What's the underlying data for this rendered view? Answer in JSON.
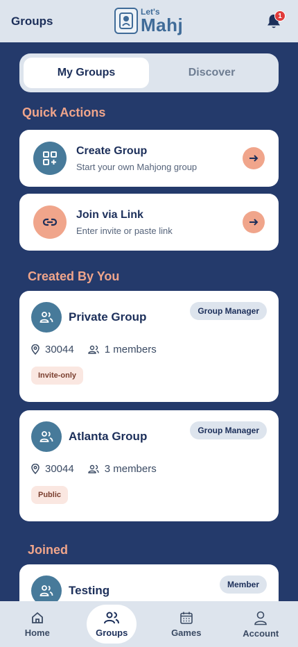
{
  "header": {
    "title": "Groups",
    "logo_small": "Let's",
    "logo_big": "Mahj",
    "notification_count": "1"
  },
  "tabs": [
    {
      "label": "My Groups"
    },
    {
      "label": "Discover"
    }
  ],
  "quick_actions": {
    "title": "Quick Actions",
    "items": [
      {
        "title": "Create Group",
        "subtitle": "Start your own Mahjong group",
        "icon": "grid-plus-icon",
        "color": "#477a9a"
      },
      {
        "title": "Join via Link",
        "subtitle": "Enter invite or paste link",
        "icon": "link-icon",
        "color": "#f0a58b"
      }
    ]
  },
  "created_by_you": {
    "title": "Created By You",
    "groups": [
      {
        "name": "Private Group",
        "role": "Group Manager",
        "zip": "30044",
        "members": "1 members",
        "visibility": "Invite-only"
      },
      {
        "name": "Atlanta Group",
        "role": "Group Manager",
        "zip": "30044",
        "members": "3 members",
        "visibility": "Public"
      }
    ]
  },
  "joined": {
    "title": "Joined",
    "groups": [
      {
        "name": "Testing",
        "role": "Member"
      }
    ]
  },
  "bottom_nav": [
    {
      "label": "Home",
      "icon": "home-icon"
    },
    {
      "label": "Groups",
      "icon": "groups-icon"
    },
    {
      "label": "Games",
      "icon": "calendar-icon"
    },
    {
      "label": "Account",
      "icon": "user-icon"
    }
  ],
  "colors": {
    "navy": "#243a6b",
    "accent": "#f0a58b",
    "teal": "#477a9a",
    "light": "#dde4ed"
  }
}
